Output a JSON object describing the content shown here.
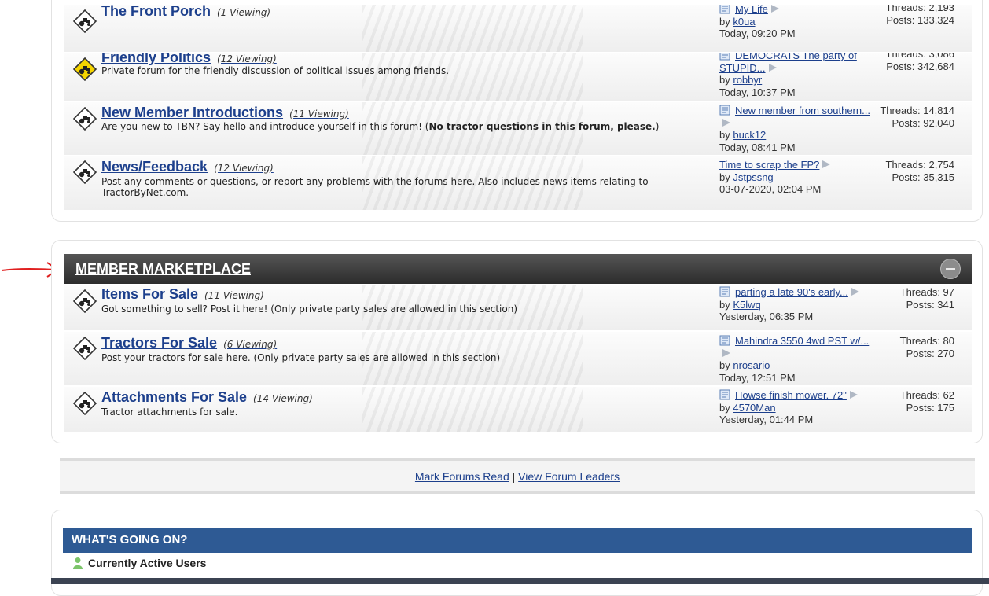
{
  "colors": {
    "link": "#1c3f8c",
    "category_bar": "#333333",
    "whats_going_on_bar": "#2e5a94",
    "annotation_arrow": "#e02020"
  },
  "community": {
    "forums": [
      {
        "title": "The Front Porch",
        "viewing": "(1 Viewing)",
        "description": "",
        "last_post": {
          "title": "My Life",
          "by": "by",
          "user": "k0ua",
          "time": "Today, 09:20 PM"
        },
        "threads": "Threads: 2,193",
        "posts": "Posts: 133,324",
        "icon": "tractor-sign-icon"
      },
      {
        "title": "Friendly Politics",
        "viewing": "(12 Viewing)",
        "description": "Private forum for the friendly discussion of political issues among friends.",
        "last_post": {
          "title": "DEMOCRATS The party of STUPID...",
          "by": "by",
          "user": "robbyr",
          "time": "Today, 10:37 PM"
        },
        "threads": "Threads: 3,086",
        "posts": "Posts: 342,684",
        "icon": "tractor-sign-new-icon"
      },
      {
        "title": "New Member Introductions",
        "viewing": "(11 Viewing)",
        "description": "Are you new to TBN? Say hello and introduce yourself in this forum! (",
        "description_bold": "No tractor questions in this forum, please.",
        "description_end": ")",
        "last_post": {
          "title": "New member from southern...",
          "by": "by",
          "user": "buck12",
          "time": "Today, 08:41 PM"
        },
        "threads": "Threads: 14,814",
        "posts": "Posts: 92,040",
        "icon": "tractor-sign-icon"
      },
      {
        "title": "News/Feedback",
        "viewing": "(12 Viewing)",
        "description": "Post any comments or questions, or report any problems with the forums here. Also includes news items relating to TractorByNet.com.",
        "last_post": {
          "title": "Time to scrap the FP?",
          "by": "by",
          "user": "Jstpssng",
          "time": "03-07-2020, 02:04 PM"
        },
        "threads": "Threads: 2,754",
        "posts": "Posts: 35,315",
        "icon": "tractor-sign-icon"
      }
    ]
  },
  "marketplace": {
    "title": "MEMBER MARKETPLACE",
    "forums": [
      {
        "title": "Items For Sale",
        "viewing": "(11 Viewing)",
        "description": "Got something to sell? Post it here! (Only private party sales are allowed in this section)",
        "last_post": {
          "title": "parting a late 90's early...",
          "by": "by",
          "user": "K5lwq",
          "time": "Yesterday, 06:35 PM"
        },
        "threads": "Threads: 97",
        "posts": "Posts: 341"
      },
      {
        "title": "Tractors For Sale",
        "viewing": "(6 Viewing)",
        "description": "Post your tractors for sale here. (Only private party sales are allowed in this section)",
        "last_post": {
          "title": "Mahindra 3550 4wd PST w/...",
          "by": "by",
          "user": "nrosario",
          "time": "Today, 12:51 PM"
        },
        "threads": "Threads: 80",
        "posts": "Posts: 270"
      },
      {
        "title": "Attachments For Sale",
        "viewing": "(14 Viewing)",
        "description": "Tractor attachments for sale.",
        "last_post": {
          "title": "Howse finish mower. 72\"",
          "by": "by",
          "user": "4570Man",
          "time": "Yesterday, 01:44 PM"
        },
        "threads": "Threads: 62",
        "posts": "Posts: 175"
      }
    ]
  },
  "footer_links": {
    "mark_read": "Mark Forums Read",
    "separator": "|",
    "leaders": "View Forum Leaders"
  },
  "whats_going_on": {
    "title": "WHAT'S GOING ON?",
    "active_users": "Currently Active Users"
  }
}
